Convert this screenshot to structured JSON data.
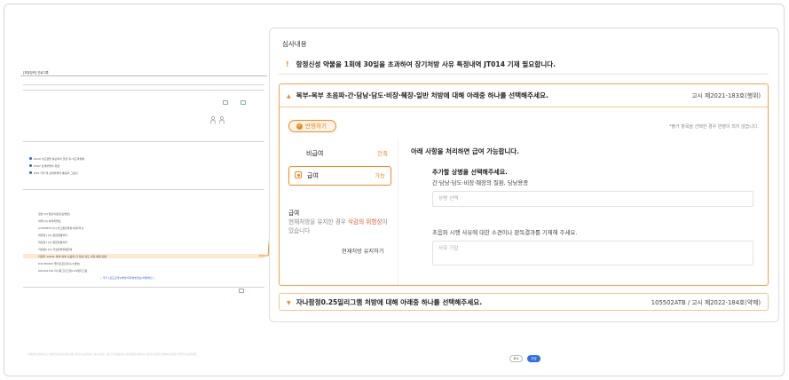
{
  "mini": {
    "window_title": "[처방입력] 진료기록",
    "rows": [
      "R229  식도염을 동반하지 않은 위-식도역류병",
      "R297  상세불명의 위염",
      "Q29  기타 및 상세불명의 통원과 그림인",
      "일반  [0] 일반의원(단순방문)",
      "외래  [0] 외래처방료",
      "A7000873  [0] 리스펜민제정1정외국산",
      "대장암1  [0] 종합영결처리",
      "위장암1  [0] 종합영결처리",
      "저설정0  [0] 자설정부위별급여",
      "자일후  19441  복부-복부 초음파-간·담낭·담도·비장·췌장-일반",
      "641050600  펠리프로린정수(1캡슐)",
      "691001740  자니틀그란고정0.25밀리그램"
    ],
    "links": "• 추가 [포도모약]/처방이력/처방정보/처방확인 •"
  },
  "panel": {
    "title": "심사내용",
    "alert": "항정신성 약물을 1회에 30일을 초과하여 장기처방 사유 특정내역 JT014 기재 필요합니다.",
    "section1": {
      "title": "복부-복부 초음파-간·담낭·담도·비장·췌장-일반 처방에 대해 아래중 하나를 선택해주세요.",
      "ref": "고시 제2021-183호(행위)",
      "apply_label": "반영하기",
      "note": "*붉가 항목을 선택한 경우 반영이 되지 않습니다.",
      "options": [
        {
          "label": "비급여",
          "status": "안족"
        },
        {
          "label": "급여",
          "status": "가능"
        }
      ],
      "option3": {
        "label": "급여",
        "desc_prefix": "현재처방을 유지한 경우 ",
        "desc_warn": "삭감의 위험성",
        "desc_suffix": "이 있습니다",
        "keep_label": "현재처방 유지하기"
      },
      "right": {
        "heading": "아래 사항을 처리하면 급여 가능합니다.",
        "sub1": "추가할 상병을 선택해주세요.",
        "sub1_desc": "간·담낭·담도·비장·췌장의 질환, 담낭용종",
        "input1_placeholder": "상병 선택",
        "sub2": "초음파 시행 사유에 대한 소견이나 판독결과를 기재해 주세요.",
        "input2_placeholder": "사유 기입"
      }
    },
    "section2": {
      "title": "자나팜정0.25밀리그램 처방에 대해 아래중 하나를 선택해주세요.",
      "ref": "105502ATB / 고시 제2022-184호(약제)"
    }
  },
  "footer": {
    "text": "*처방이력 확인하시고 처방입력이 완료되면 저장 버튼을 눌러주세요. 심사 결과는 저장 후 반영됩니다. 심사내용을 확인하고 필요한 항목을 선택하여 반영하기 버튼을 눌러주세요.",
    "cancel": "취소",
    "save": "저장"
  },
  "colors": {
    "accent": "#f08a1c",
    "primary": "#2f6fe5",
    "warn": "#e05a2b"
  }
}
